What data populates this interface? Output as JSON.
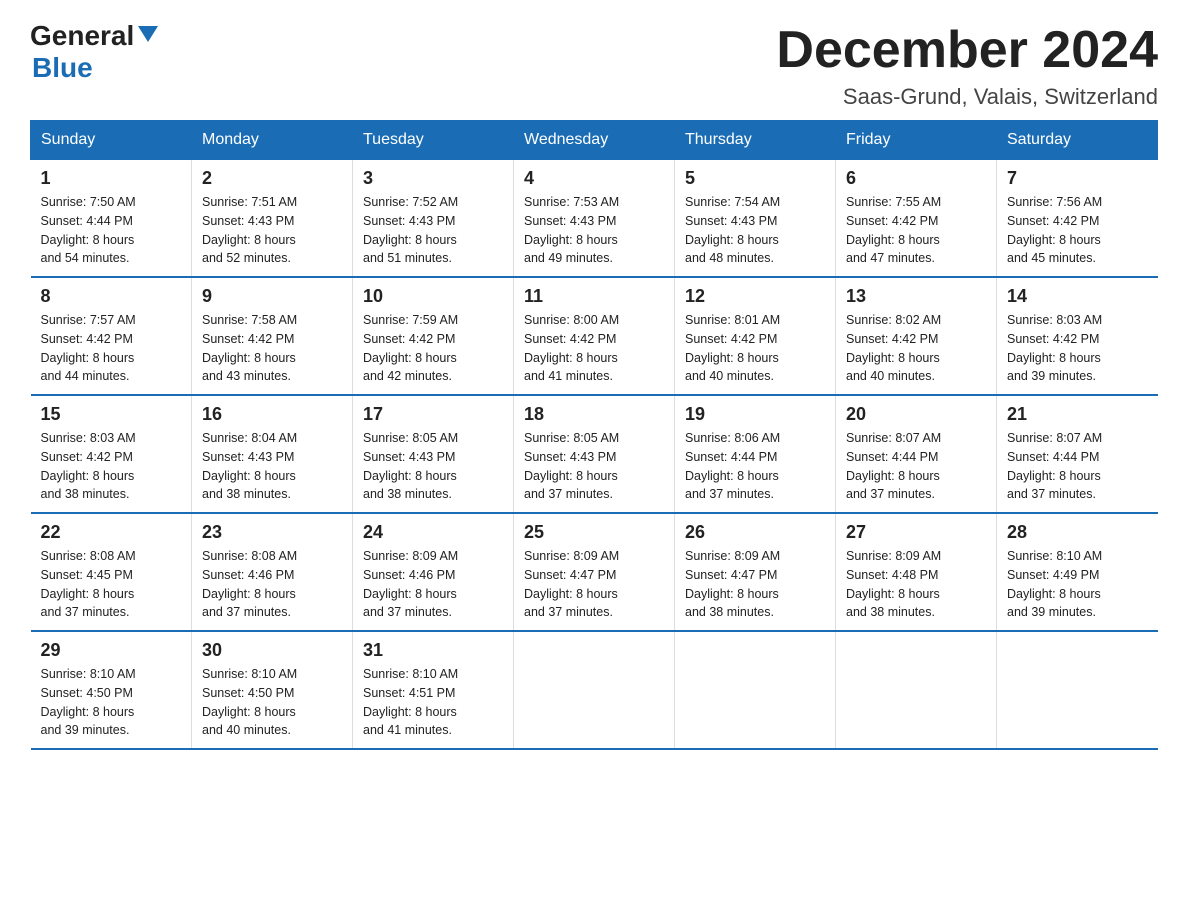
{
  "logo": {
    "general": "General",
    "blue": "Blue"
  },
  "title": {
    "month": "December 2024",
    "location": "Saas-Grund, Valais, Switzerland"
  },
  "days_of_week": [
    "Sunday",
    "Monday",
    "Tuesday",
    "Wednesday",
    "Thursday",
    "Friday",
    "Saturday"
  ],
  "weeks": [
    [
      {
        "day": "1",
        "sunrise": "7:50 AM",
        "sunset": "4:44 PM",
        "daylight_hours": "8",
        "daylight_minutes": "54"
      },
      {
        "day": "2",
        "sunrise": "7:51 AM",
        "sunset": "4:43 PM",
        "daylight_hours": "8",
        "daylight_minutes": "52"
      },
      {
        "day": "3",
        "sunrise": "7:52 AM",
        "sunset": "4:43 PM",
        "daylight_hours": "8",
        "daylight_minutes": "51"
      },
      {
        "day": "4",
        "sunrise": "7:53 AM",
        "sunset": "4:43 PM",
        "daylight_hours": "8",
        "daylight_minutes": "49"
      },
      {
        "day": "5",
        "sunrise": "7:54 AM",
        "sunset": "4:43 PM",
        "daylight_hours": "8",
        "daylight_minutes": "48"
      },
      {
        "day": "6",
        "sunrise": "7:55 AM",
        "sunset": "4:42 PM",
        "daylight_hours": "8",
        "daylight_minutes": "47"
      },
      {
        "day": "7",
        "sunrise": "7:56 AM",
        "sunset": "4:42 PM",
        "daylight_hours": "8",
        "daylight_minutes": "45"
      }
    ],
    [
      {
        "day": "8",
        "sunrise": "7:57 AM",
        "sunset": "4:42 PM",
        "daylight_hours": "8",
        "daylight_minutes": "44"
      },
      {
        "day": "9",
        "sunrise": "7:58 AM",
        "sunset": "4:42 PM",
        "daylight_hours": "8",
        "daylight_minutes": "43"
      },
      {
        "day": "10",
        "sunrise": "7:59 AM",
        "sunset": "4:42 PM",
        "daylight_hours": "8",
        "daylight_minutes": "42"
      },
      {
        "day": "11",
        "sunrise": "8:00 AM",
        "sunset": "4:42 PM",
        "daylight_hours": "8",
        "daylight_minutes": "41"
      },
      {
        "day": "12",
        "sunrise": "8:01 AM",
        "sunset": "4:42 PM",
        "daylight_hours": "8",
        "daylight_minutes": "40"
      },
      {
        "day": "13",
        "sunrise": "8:02 AM",
        "sunset": "4:42 PM",
        "daylight_hours": "8",
        "daylight_minutes": "40"
      },
      {
        "day": "14",
        "sunrise": "8:03 AM",
        "sunset": "4:42 PM",
        "daylight_hours": "8",
        "daylight_minutes": "39"
      }
    ],
    [
      {
        "day": "15",
        "sunrise": "8:03 AM",
        "sunset": "4:42 PM",
        "daylight_hours": "8",
        "daylight_minutes": "38"
      },
      {
        "day": "16",
        "sunrise": "8:04 AM",
        "sunset": "4:43 PM",
        "daylight_hours": "8",
        "daylight_minutes": "38"
      },
      {
        "day": "17",
        "sunrise": "8:05 AM",
        "sunset": "4:43 PM",
        "daylight_hours": "8",
        "daylight_minutes": "38"
      },
      {
        "day": "18",
        "sunrise": "8:05 AM",
        "sunset": "4:43 PM",
        "daylight_hours": "8",
        "daylight_minutes": "37"
      },
      {
        "day": "19",
        "sunrise": "8:06 AM",
        "sunset": "4:44 PM",
        "daylight_hours": "8",
        "daylight_minutes": "37"
      },
      {
        "day": "20",
        "sunrise": "8:07 AM",
        "sunset": "4:44 PM",
        "daylight_hours": "8",
        "daylight_minutes": "37"
      },
      {
        "day": "21",
        "sunrise": "8:07 AM",
        "sunset": "4:44 PM",
        "daylight_hours": "8",
        "daylight_minutes": "37"
      }
    ],
    [
      {
        "day": "22",
        "sunrise": "8:08 AM",
        "sunset": "4:45 PM",
        "daylight_hours": "8",
        "daylight_minutes": "37"
      },
      {
        "day": "23",
        "sunrise": "8:08 AM",
        "sunset": "4:46 PM",
        "daylight_hours": "8",
        "daylight_minutes": "37"
      },
      {
        "day": "24",
        "sunrise": "8:09 AM",
        "sunset": "4:46 PM",
        "daylight_hours": "8",
        "daylight_minutes": "37"
      },
      {
        "day": "25",
        "sunrise": "8:09 AM",
        "sunset": "4:47 PM",
        "daylight_hours": "8",
        "daylight_minutes": "37"
      },
      {
        "day": "26",
        "sunrise": "8:09 AM",
        "sunset": "4:47 PM",
        "daylight_hours": "8",
        "daylight_minutes": "38"
      },
      {
        "day": "27",
        "sunrise": "8:09 AM",
        "sunset": "4:48 PM",
        "daylight_hours": "8",
        "daylight_minutes": "38"
      },
      {
        "day": "28",
        "sunrise": "8:10 AM",
        "sunset": "4:49 PM",
        "daylight_hours": "8",
        "daylight_minutes": "39"
      }
    ],
    [
      {
        "day": "29",
        "sunrise": "8:10 AM",
        "sunset": "4:50 PM",
        "daylight_hours": "8",
        "daylight_minutes": "39"
      },
      {
        "day": "30",
        "sunrise": "8:10 AM",
        "sunset": "4:50 PM",
        "daylight_hours": "8",
        "daylight_minutes": "40"
      },
      {
        "day": "31",
        "sunrise": "8:10 AM",
        "sunset": "4:51 PM",
        "daylight_hours": "8",
        "daylight_minutes": "41"
      },
      null,
      null,
      null,
      null
    ]
  ]
}
